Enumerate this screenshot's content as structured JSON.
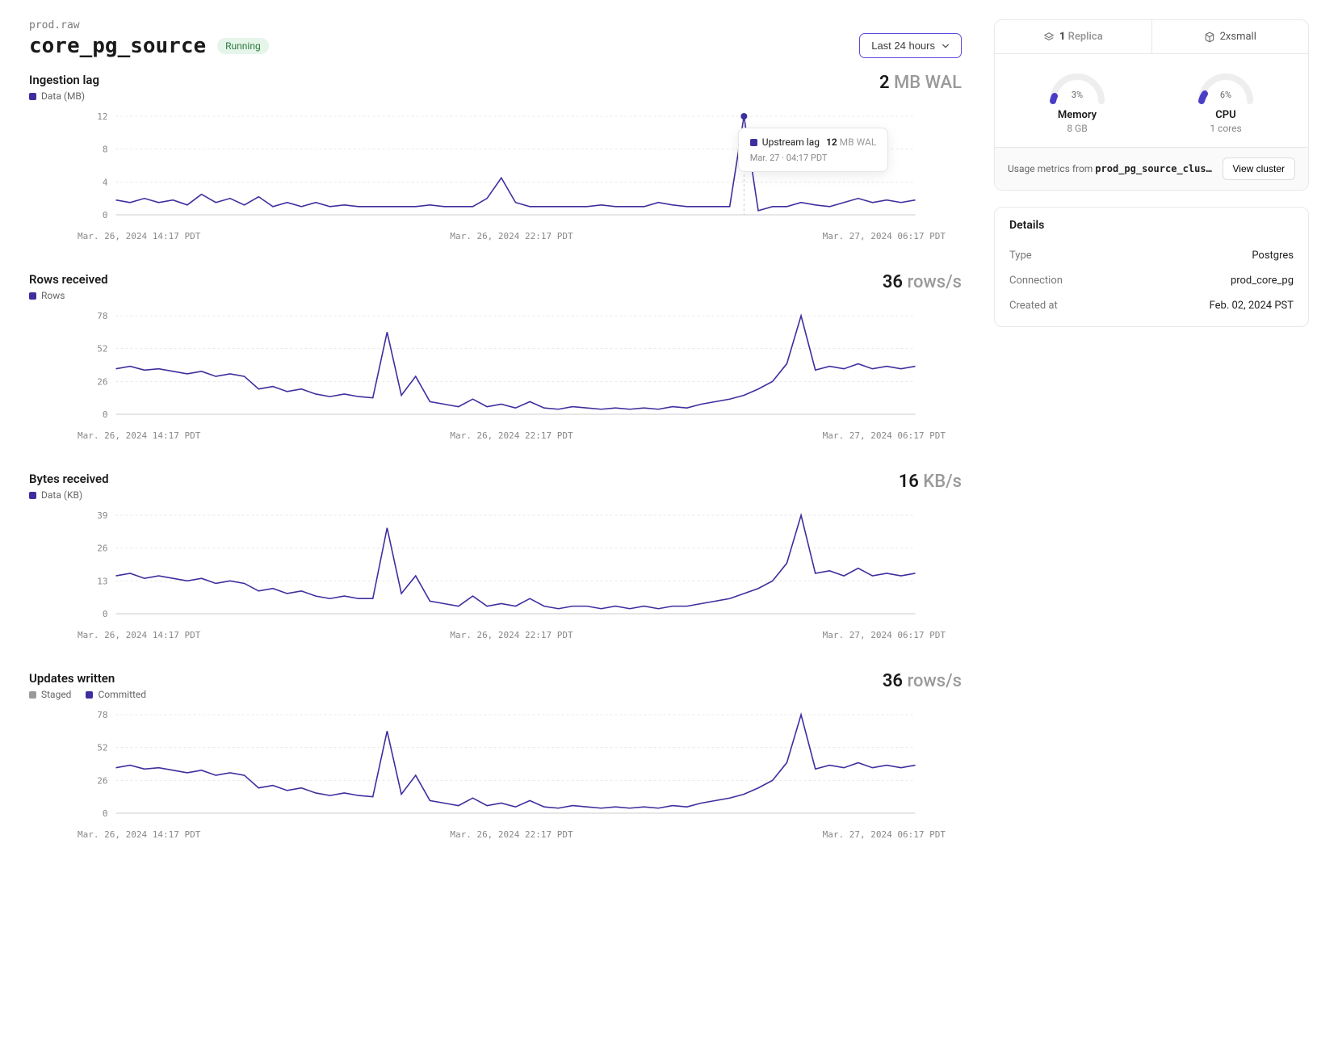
{
  "breadcrumb": "prod.raw",
  "title": "core_pg_source",
  "status": "Running",
  "range_label": "Last 24 hours",
  "tooltip": {
    "series": "Upstream lag",
    "value": "12",
    "unit": "MB WAL",
    "time": "Mar. 27 · 04:17 PDT"
  },
  "side": {
    "replica_tab": {
      "count": "1",
      "label": "Replica"
    },
    "size_tab": {
      "label": "2xsmall"
    },
    "memory": {
      "pct": "3%",
      "label": "Memory",
      "sub": "8 GB"
    },
    "cpu": {
      "pct": "6%",
      "label": "CPU",
      "sub": "1 cores"
    },
    "usage_prefix": "Usage metrics from ",
    "cluster_name": "prod_pg_source_clus…",
    "view_btn": "View cluster",
    "details_title": "Details",
    "details": {
      "type_k": "Type",
      "type_v": "Postgres",
      "conn_k": "Connection",
      "conn_v": "prod_core_pg",
      "created_k": "Created at",
      "created_v": "Feb. 02, 2024 PST"
    }
  },
  "charts": [
    {
      "title": "Ingestion lag",
      "legend": [
        {
          "label": "Data (MB)",
          "color": "data"
        }
      ],
      "summary_value": "2",
      "summary_unit": "MB WAL",
      "x_ticks": [
        "Mar. 26, 2024 14:17 PDT",
        "Mar. 26, 2024 22:17 PDT",
        "Mar. 27, 2024 06:17 PDT"
      ]
    },
    {
      "title": "Rows received",
      "legend": [
        {
          "label": "Rows",
          "color": "data"
        }
      ],
      "summary_value": "36",
      "summary_unit": "rows/s",
      "x_ticks": [
        "Mar. 26, 2024 14:17 PDT",
        "Mar. 26, 2024 22:17 PDT",
        "Mar. 27, 2024 06:17 PDT"
      ]
    },
    {
      "title": "Bytes received",
      "legend": [
        {
          "label": "Data (KB)",
          "color": "data"
        }
      ],
      "summary_value": "16",
      "summary_unit": "KB/s",
      "x_ticks": [
        "Mar. 26, 2024 14:17 PDT",
        "Mar. 26, 2024 22:17 PDT",
        "Mar. 27, 2024 06:17 PDT"
      ]
    },
    {
      "title": "Updates written",
      "legend": [
        {
          "label": "Staged",
          "color": "stage"
        },
        {
          "label": "Committed",
          "color": "data"
        }
      ],
      "summary_value": "36",
      "summary_unit": "rows/s",
      "x_ticks": [
        "Mar. 26, 2024 14:17 PDT",
        "Mar. 26, 2024 22:17 PDT",
        "Mar. 27, 2024 06:17 PDT"
      ]
    }
  ],
  "chart_data": [
    {
      "type": "line",
      "title": "Ingestion lag",
      "ylabel": "Data (MB)",
      "ylim": [
        0,
        12
      ],
      "y_ticks": [
        0,
        4,
        8,
        12
      ],
      "x_ticks": [
        "Mar. 26, 2024 14:17 PDT",
        "Mar. 26, 2024 22:17 PDT",
        "Mar. 27, 2024 06:17 PDT"
      ],
      "series": [
        {
          "name": "Data (MB)",
          "values": [
            1.8,
            1.5,
            2,
            1.5,
            1.8,
            1.2,
            2.5,
            1.5,
            2,
            1.2,
            2.2,
            1,
            1.5,
            1,
            1.5,
            1,
            1.2,
            1,
            1,
            1,
            1,
            1,
            1.2,
            1,
            1,
            1,
            2,
            4.5,
            1.5,
            1,
            1,
            1,
            1,
            1,
            1.2,
            1,
            1,
            1,
            1.5,
            1.2,
            1,
            1,
            1,
            1,
            12,
            0.5,
            1,
            1,
            1.5,
            1.2,
            1,
            1.5,
            2,
            1.5,
            1.8,
            1.5,
            1.8
          ]
        }
      ]
    },
    {
      "type": "line",
      "title": "Rows received",
      "ylabel": "Rows",
      "ylim": [
        0,
        78
      ],
      "y_ticks": [
        0,
        26,
        52,
        78
      ],
      "x_ticks": [
        "Mar. 26, 2024 14:17 PDT",
        "Mar. 26, 2024 22:17 PDT",
        "Mar. 27, 2024 06:17 PDT"
      ],
      "series": [
        {
          "name": "Rows",
          "values": [
            36,
            38,
            35,
            36,
            34,
            32,
            34,
            30,
            32,
            30,
            20,
            22,
            18,
            20,
            16,
            14,
            16,
            14,
            13,
            65,
            15,
            30,
            10,
            8,
            6,
            12,
            6,
            8,
            5,
            10,
            5,
            4,
            6,
            5,
            4,
            5,
            4,
            5,
            4,
            6,
            5,
            8,
            10,
            12,
            15,
            20,
            26,
            40,
            78,
            35,
            38,
            36,
            40,
            36,
            38,
            36,
            38
          ]
        }
      ]
    },
    {
      "type": "line",
      "title": "Bytes received",
      "ylabel": "Data (KB)",
      "ylim": [
        0,
        39
      ],
      "y_ticks": [
        0,
        13,
        26,
        39
      ],
      "x_ticks": [
        "Mar. 26, 2024 14:17 PDT",
        "Mar. 26, 2024 22:17 PDT",
        "Mar. 27, 2024 06:17 PDT"
      ],
      "series": [
        {
          "name": "Data (KB)",
          "values": [
            15,
            16,
            14,
            15,
            14,
            13,
            14,
            12,
            13,
            12,
            9,
            10,
            8,
            9,
            7,
            6,
            7,
            6,
            6,
            34,
            8,
            15,
            5,
            4,
            3,
            7,
            3,
            4,
            3,
            6,
            3,
            2,
            3,
            3,
            2,
            3,
            2,
            3,
            2,
            3,
            3,
            4,
            5,
            6,
            8,
            10,
            13,
            20,
            39,
            16,
            17,
            15,
            18,
            15,
            16,
            15,
            16
          ]
        }
      ]
    },
    {
      "type": "line",
      "title": "Updates written",
      "ylabel": "rows/s",
      "ylim": [
        0,
        78
      ],
      "y_ticks": [
        0,
        26,
        52,
        78
      ],
      "x_ticks": [
        "Mar. 26, 2024 14:17 PDT",
        "Mar. 26, 2024 22:17 PDT",
        "Mar. 27, 2024 06:17 PDT"
      ],
      "series": [
        {
          "name": "Staged",
          "values": []
        },
        {
          "name": "Committed",
          "values": [
            36,
            38,
            35,
            36,
            34,
            32,
            34,
            30,
            32,
            30,
            20,
            22,
            18,
            20,
            16,
            14,
            16,
            14,
            13,
            65,
            15,
            30,
            10,
            8,
            6,
            12,
            6,
            8,
            5,
            10,
            5,
            4,
            6,
            5,
            4,
            5,
            4,
            5,
            4,
            6,
            5,
            8,
            10,
            12,
            15,
            20,
            26,
            40,
            78,
            35,
            38,
            36,
            40,
            36,
            38,
            36,
            38
          ]
        }
      ]
    }
  ]
}
